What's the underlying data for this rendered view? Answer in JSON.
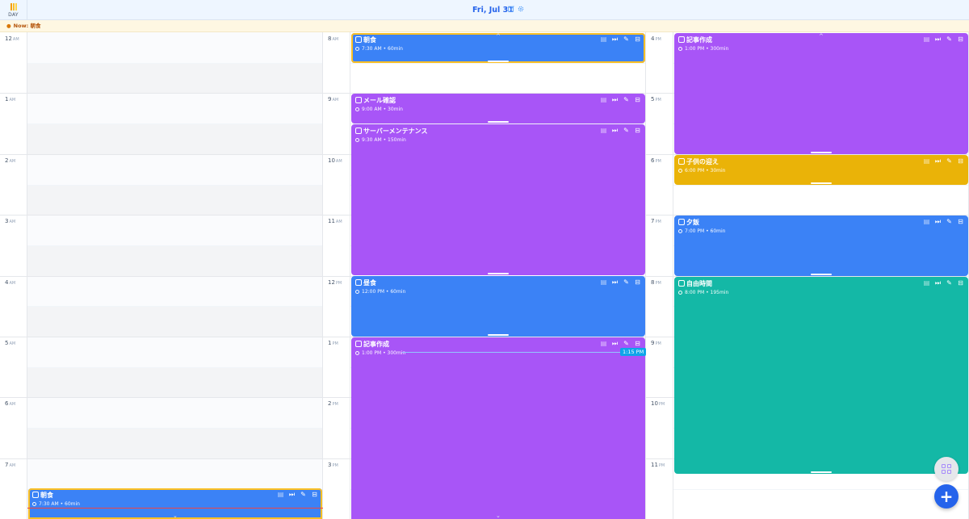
{
  "header": {
    "view_label": "DAY",
    "date": "Fri, Jul 31"
  },
  "now_bar": {
    "label": "Now: 朝食"
  },
  "current_time_label": "1:15 PM",
  "columns": [
    {
      "hours": [
        {
          "n": "12",
          "ap": "AM"
        },
        {
          "n": "1",
          "ap": "AM"
        },
        {
          "n": "2",
          "ap": "AM"
        },
        {
          "n": "3",
          "ap": "AM"
        },
        {
          "n": "4",
          "ap": "AM"
        },
        {
          "n": "5",
          "ap": "AM"
        },
        {
          "n": "6",
          "ap": "AM"
        },
        {
          "n": "7",
          "ap": "AM"
        }
      ]
    },
    {
      "hours": [
        {
          "n": "8",
          "ap": "AM"
        },
        {
          "n": "9",
          "ap": "AM"
        },
        {
          "n": "10",
          "ap": "AM"
        },
        {
          "n": "11",
          "ap": "AM"
        },
        {
          "n": "12",
          "ap": "PM"
        },
        {
          "n": "1",
          "ap": "PM"
        },
        {
          "n": "2",
          "ap": "PM"
        },
        {
          "n": "3",
          "ap": "PM"
        }
      ]
    },
    {
      "hours": [
        {
          "n": "4",
          "ap": "PM"
        },
        {
          "n": "5",
          "ap": "PM"
        },
        {
          "n": "6",
          "ap": "PM"
        },
        {
          "n": "7",
          "ap": "PM"
        },
        {
          "n": "8",
          "ap": "PM"
        },
        {
          "n": "9",
          "ap": "PM"
        },
        {
          "n": "10",
          "ap": "PM"
        },
        {
          "n": "11",
          "ap": "PM"
        }
      ]
    }
  ],
  "events": [
    {
      "title": "朝食",
      "meta": "7:30 AM • 60min",
      "color": "#3b82f6"
    },
    {
      "title": "メール確認",
      "meta": "9:00 AM • 30min",
      "color": "#a855f7"
    },
    {
      "title": "サーバーメンテナンス",
      "meta": "9:30 AM • 150min",
      "color": "#a855f7"
    },
    {
      "title": "昼食",
      "meta": "12:00 PM • 60min",
      "color": "#3b82f6"
    },
    {
      "title": "記事作成",
      "meta": "1:00 PM • 300min",
      "color": "#a855f7"
    },
    {
      "title": "子供の迎え",
      "meta": "6:00 PM • 30min",
      "color": "#eab308"
    },
    {
      "title": "夕飯",
      "meta": "7:00 PM • 60min",
      "color": "#3b82f6"
    },
    {
      "title": "自由時間",
      "meta": "8:00 PM • 195min",
      "color": "#14b8a6"
    }
  ]
}
